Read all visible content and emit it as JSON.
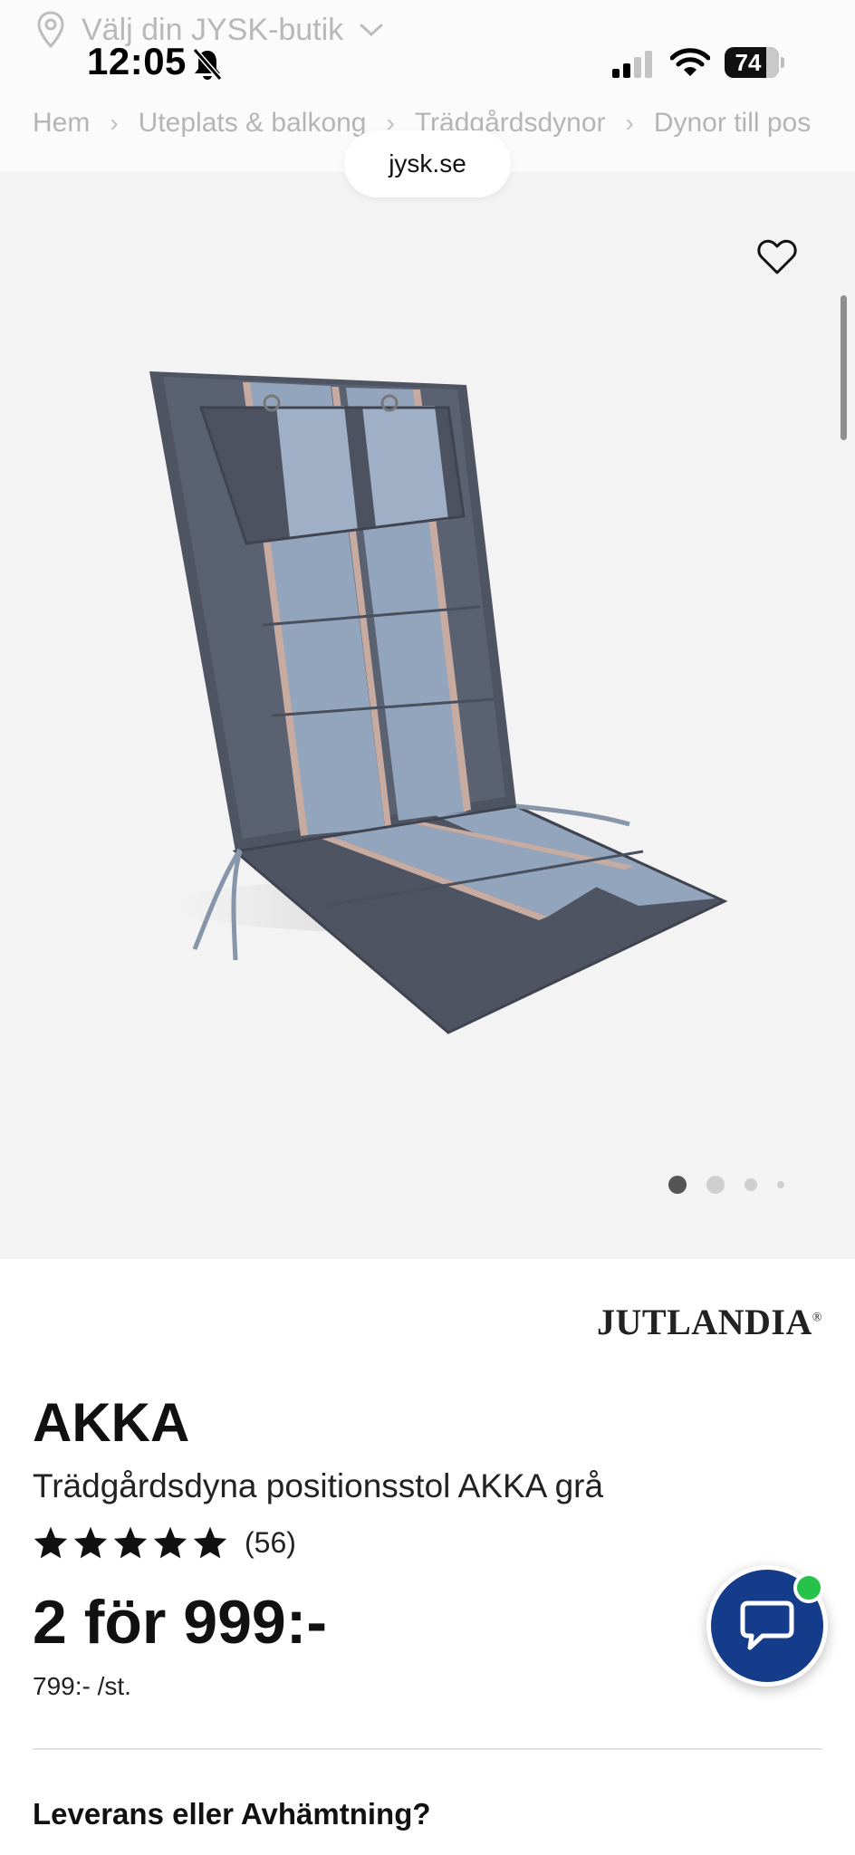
{
  "status_bar": {
    "time": "12:05",
    "battery": "74",
    "icons": [
      "bell-slash-icon",
      "signal-icon",
      "wifi-icon",
      "battery-icon"
    ]
  },
  "header": {
    "store_label": "Välj din JYSK-butik",
    "breadcrumb": [
      "Hem",
      "Uteplats & balkong",
      "Trädgårdsdynor",
      "Dynor till pos"
    ],
    "url": "jysk.se"
  },
  "gallery": {
    "dot_count": 4,
    "active_index": 0,
    "product_colors": {
      "light_stripe": "#93a5bd",
      "dark_stripe": "#4e5461",
      "accent_stripe": "#c7aaa0"
    }
  },
  "product": {
    "brand": "JUTLANDIA",
    "brand_mark": "®",
    "name": "AKKA",
    "description": "Trädgårdsdyna positionsstol AKKA grå",
    "rating_value": 5,
    "review_count": "(56)",
    "price": "2 för 999:-",
    "unit_price": "799:- /st."
  },
  "delivery": {
    "heading": "Leverans eller Avhämtning?"
  },
  "colors": {
    "chat_button": "#143c8a",
    "online_indicator": "#26c24a",
    "gallery_bg": "#f3f3f3"
  }
}
